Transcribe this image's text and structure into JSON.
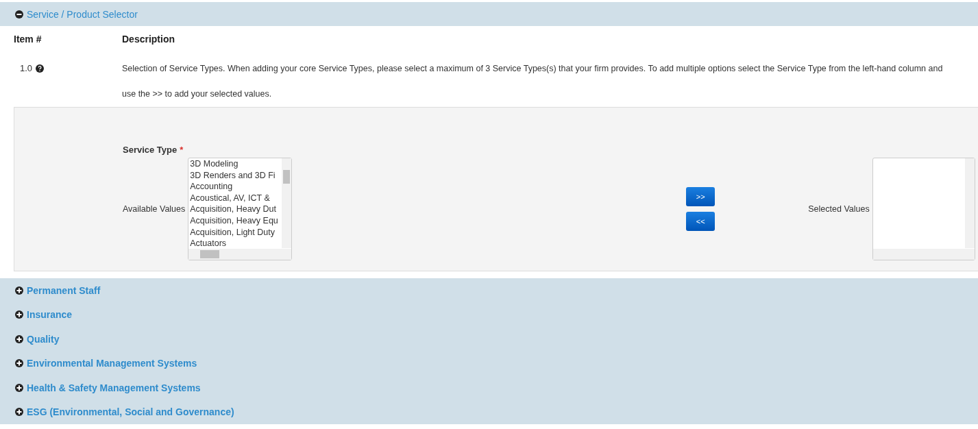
{
  "sections": [
    {
      "title": "Service / Product Selector",
      "expanded": true,
      "columns": [
        "Item #",
        "Description"
      ],
      "rows": [
        {
          "item": "1.0",
          "description": "Selection of Service Types. When adding your core Service Types, please select a maximum of 3 Service Types(s) that your firm provides. To add multiple options select the Service Type from the left-hand column and use the >> to add your selected values."
        }
      ],
      "picker": {
        "label": "Service Type",
        "required_mark": "*",
        "available_label": "Available Values",
        "available_values": [
          "3D Modeling",
          "3D Renders and 3D Fi",
          "Accounting",
          "Acoustical, AV, ICT &",
          "Acquisition, Heavy Dut",
          "Acquisition, Heavy Equ",
          "Acquisition, Light Duty",
          "Actuators"
        ],
        "add_button": ">>",
        "remove_button": "<<",
        "selected_label": "Selected Values"
      }
    },
    {
      "title": "Permanent Staff",
      "expanded": false
    },
    {
      "title": "Insurance",
      "expanded": false
    },
    {
      "title": "Quality",
      "expanded": false
    },
    {
      "title": "Environmental Management Systems",
      "expanded": false
    },
    {
      "title": "Health & Safety Management Systems",
      "expanded": false
    },
    {
      "title": "ESG (Environmental, Social and Governance)",
      "expanded": false
    }
  ]
}
